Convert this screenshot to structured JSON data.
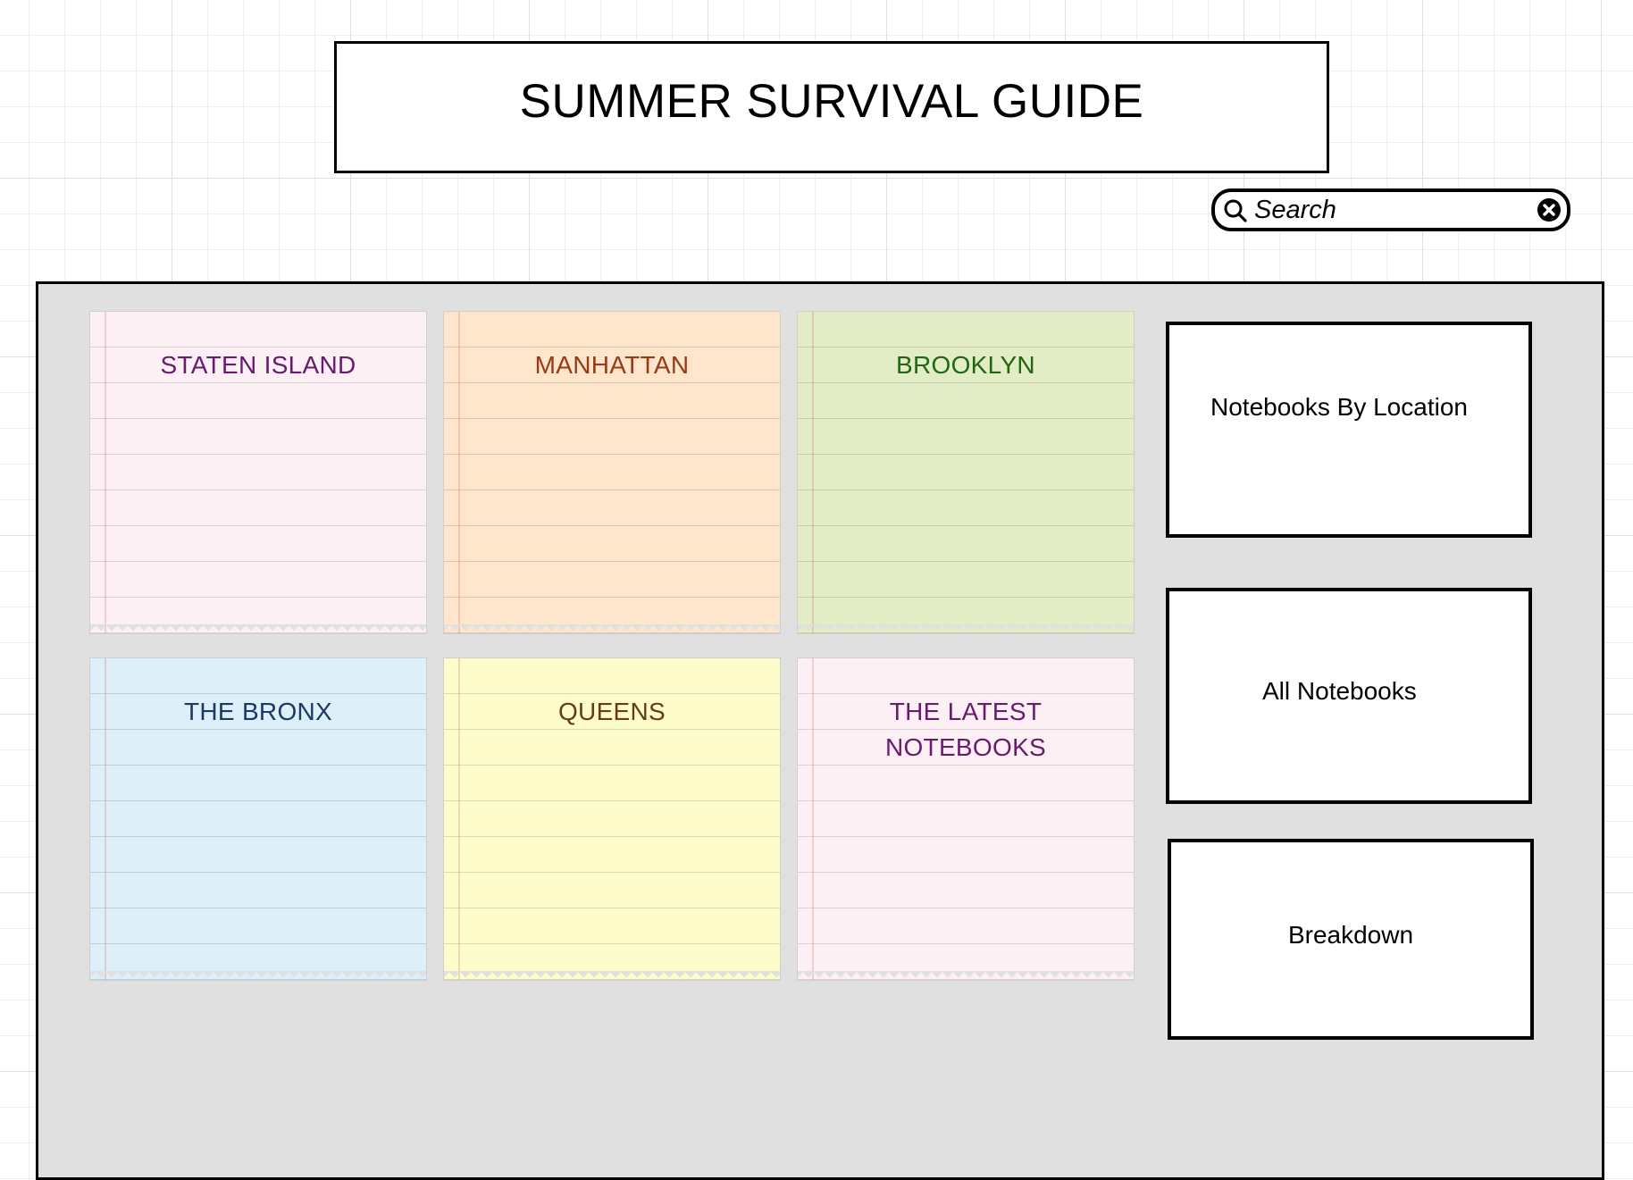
{
  "header": {
    "title": "SUMMER SURVIVAL GUIDE"
  },
  "search": {
    "placeholder": "Search",
    "search_icon": "search-icon",
    "clear_icon": "close-circle-icon"
  },
  "notebooks": [
    {
      "label": "STATEN ISLAND",
      "bg": "#fdf0f4",
      "color": "#6a1a6e"
    },
    {
      "label": "MANHATTAN",
      "bg": "#fde6cc",
      "color": "#9a3a14"
    },
    {
      "label": "BROOKLYN",
      "bg": "#e2edc5",
      "color": "#226612"
    },
    {
      "label": "THE BRONX",
      "bg": "#ddeff8",
      "color": "#1a3a66"
    },
    {
      "label": "QUEENS",
      "bg": "#fdfcca",
      "color": "#6a3a14"
    },
    {
      "label": "THE LATEST\nNOTEBOOKS",
      "bg": "#fdf0f4",
      "color": "#6a1a6e"
    }
  ],
  "nav": {
    "by_location": "Notebooks By Location",
    "all_notebooks": "All Notebooks",
    "breakdown": "Breakdown"
  }
}
